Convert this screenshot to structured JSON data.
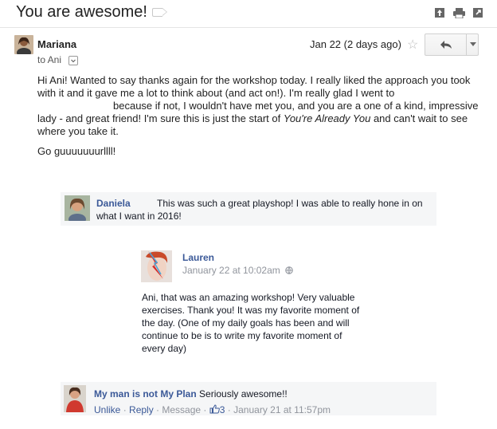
{
  "email": {
    "subject": "You are awesome!",
    "sender": "Mariana",
    "to": "to Ani",
    "date": "Jan 22 (2 days ago)",
    "body_line1": "Hi Ani! Wanted to say thanks again for the workshop today. I really liked the approach you took with it and it gave me a lot to think about (and act on!). I'm really glad I went to",
    "body_line2a": "because if not, I wouldn't have met you, and you are a one of a kind, impressive lady - and great friend! I'm sure this is just the start of",
    "body_italic": "You're Already You",
    "body_line2b": "and can't wait to see where you take it.",
    "sign_off": "Go guuuuuuurllll!"
  },
  "comments": [
    {
      "name": "Daniela",
      "text": "This was such a great playshop! I was able to really hone in on what I want in 2016!"
    },
    {
      "name": "Lauren",
      "date": "January 22 at 10:02am",
      "text": "Ani, that was an amazing workshop! Very valuable exercises. Thank you! It was my favorite moment of the day. (One of my daily goals has been and will continue to be is to write my favorite moment of every day)"
    },
    {
      "name": "My man is not My Plan",
      "text": "Seriously awesome!!",
      "unlike": "Unlike",
      "reply": "Reply",
      "message": "Message",
      "likes": "3",
      "date": "January 21 at 11:57pm"
    }
  ],
  "icons": {
    "archive": "archive-icon",
    "print": "print-icon",
    "new_window": "new-window-icon",
    "star": "star-icon",
    "reply": "reply-icon",
    "more": "chevron-down-icon",
    "globe": "globe-icon",
    "like": "thumbs-up-icon"
  },
  "colors": {
    "facebook_blue": "#3b5998",
    "comment_bg": "#f5f6f7"
  }
}
